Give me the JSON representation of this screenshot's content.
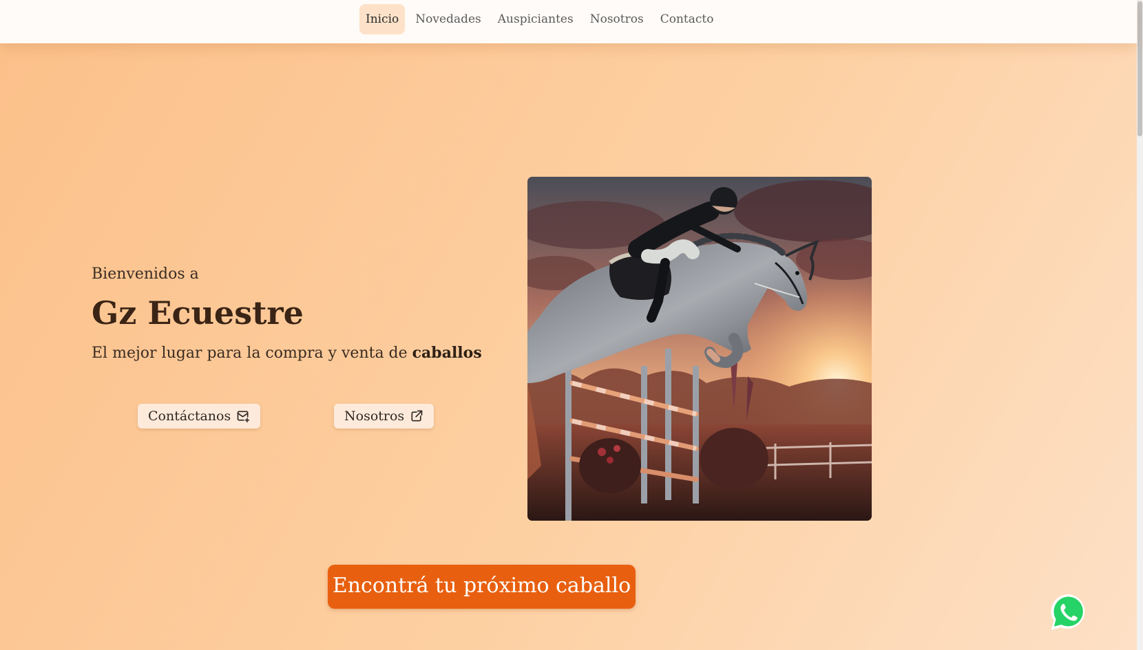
{
  "nav": {
    "items": [
      {
        "label": "Inicio",
        "active": true
      },
      {
        "label": "Novedades",
        "active": false
      },
      {
        "label": "Auspiciantes",
        "active": false
      },
      {
        "label": "Nosotros",
        "active": false
      },
      {
        "label": "Contacto",
        "active": false
      }
    ]
  },
  "hero": {
    "welcome": "Bienvenidos a",
    "title": "Gz Ecuestre",
    "tagline_prefix": "El mejor lugar para la compra y venta de ",
    "tagline_bold": "caballos",
    "buttons": {
      "contact_label": "Contáctanos",
      "contact_icon": "mail-plus-icon",
      "about_label": "Nosotros",
      "about_icon": "external-link-icon"
    },
    "image_icon": "horse-jumping-photo"
  },
  "cta": {
    "label": "Encontrá tu próximo caballo"
  },
  "floating": {
    "whatsapp_icon": "whatsapp-icon"
  },
  "colors": {
    "accent": "#e8600f",
    "nav_active_bg": "#fde2c9",
    "page_bg_start": "#fcc08a",
    "page_bg_end": "#fde0c6",
    "whatsapp": "#25d366"
  }
}
